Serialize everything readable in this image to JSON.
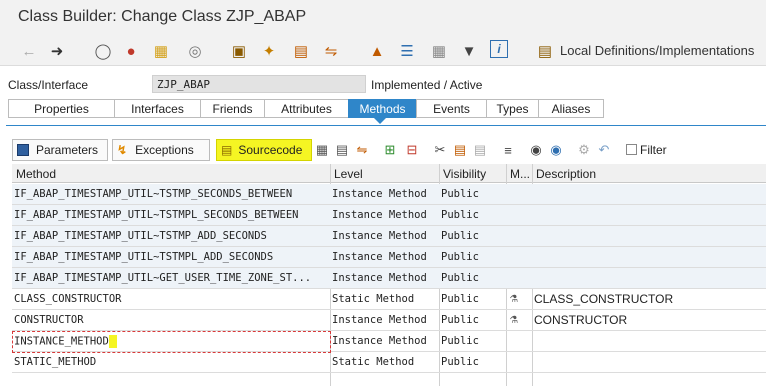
{
  "window": {
    "title": "Class Builder: Change Class ZJP_ABAP"
  },
  "toolbar": {
    "icons": [
      "back-icon",
      "forward-icon",
      "glasses-icon",
      "cluster-icon",
      "paste-icon",
      "ring-icon",
      "hierarchy-icon",
      "magic-wand-icon",
      "text-icon",
      "hand-icon",
      "tree-icon",
      "stack-icon",
      "table-icon",
      "filter-icon",
      "info-icon",
      "local-definitions-icon"
    ],
    "local_definitions_label": "Local Definitions/Implementations"
  },
  "header": {
    "class_label": "Class/Interface",
    "class_value": "ZJP_ABAP",
    "status": "Implemented / Active"
  },
  "tabs": [
    {
      "label": "Properties",
      "active": false
    },
    {
      "label": "Interfaces",
      "active": false
    },
    {
      "label": "Friends",
      "active": false
    },
    {
      "label": "Attributes",
      "active": false
    },
    {
      "label": "Methods",
      "active": true
    },
    {
      "label": "Events",
      "active": false
    },
    {
      "label": "Types",
      "active": false
    },
    {
      "label": "Aliases",
      "active": false
    }
  ],
  "sub_toolbar": {
    "parameters_label": "Parameters",
    "exceptions_label": "Exceptions",
    "sourcecode_label": "Sourcecode",
    "filter_label": "Filter"
  },
  "grid": {
    "headers": {
      "method": "Method",
      "level": "Level",
      "visibility": "Visibility",
      "m": "M...",
      "description": "Description"
    },
    "rows": [
      {
        "method": "IF_ABAP_TIMESTAMP_UTIL~TSTMP_SECONDS_BETWEEN",
        "level": "Instance Method",
        "visibility": "Public",
        "m": "",
        "description": ""
      },
      {
        "method": "IF_ABAP_TIMESTAMP_UTIL~TSTMPL_SECONDS_BETWEEN",
        "level": "Instance Method",
        "visibility": "Public",
        "m": "",
        "description": ""
      },
      {
        "method": "IF_ABAP_TIMESTAMP_UTIL~TSTMP_ADD_SECONDS",
        "level": "Instance Method",
        "visibility": "Public",
        "m": "",
        "description": ""
      },
      {
        "method": "IF_ABAP_TIMESTAMP_UTIL~TSTMPL_ADD_SECONDS",
        "level": "Instance Method",
        "visibility": "Public",
        "m": "",
        "description": ""
      },
      {
        "method": "IF_ABAP_TIMESTAMP_UTIL~GET_USER_TIME_ZONE_ST...",
        "level": "Instance Method",
        "visibility": "Public",
        "m": "",
        "description": ""
      },
      {
        "method": "CLASS_CONSTRUCTOR",
        "level": "Static Method",
        "visibility": "Public",
        "m": "method-icon",
        "description": "CLASS_CONSTRUCTOR"
      },
      {
        "method": "CONSTRUCTOR",
        "level": "Instance Method",
        "visibility": "Public",
        "m": "method-icon",
        "description": "CONSTRUCTOR"
      },
      {
        "method": "INSTANCE_METHOD",
        "level": "Instance Method",
        "visibility": "Public",
        "m": "",
        "description": ""
      },
      {
        "method": "STATIC_METHOD",
        "level": "Static Method",
        "visibility": "Public",
        "m": "",
        "description": ""
      }
    ]
  },
  "colors": {
    "active_tab": "#2f86c9",
    "highlight": "#f5f523",
    "focus_border": "#d73a3a"
  }
}
